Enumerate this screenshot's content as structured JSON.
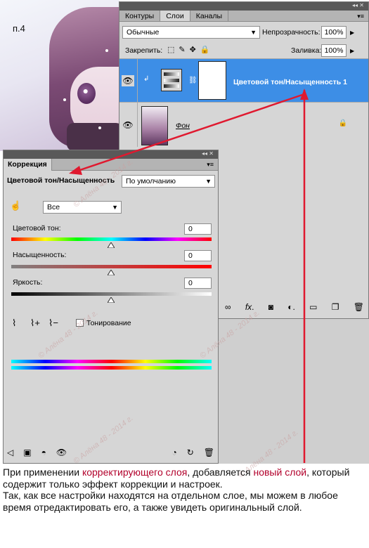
{
  "step_label": "п.4",
  "layers_panel": {
    "tabs": [
      "Контуры",
      "Слои",
      "Каналы"
    ],
    "active_tab": "Слои",
    "blend_mode": "Обычные",
    "opacity_label": "Непрозрачность:",
    "opacity_value": "100%",
    "lock_label": "Закрепить:",
    "fill_label": "Заливка:",
    "fill_value": "100%",
    "layers": [
      {
        "name": "Цветовой тон/Насыщенность 1",
        "selected": true
      },
      {
        "name": "Фон",
        "selected": false
      }
    ]
  },
  "correction_panel": {
    "tab": "Коррекция",
    "adjustment_title": "Цветовой тон/Насыщенность",
    "preset": "По умолчанию",
    "channel": "Все",
    "hue_label": "Цветовой тон:",
    "hue_value": "0",
    "saturation_label": "Насыщенность:",
    "saturation_value": "0",
    "lightness_label": "Яркость:",
    "lightness_value": "0",
    "colorize_label": "Тонирование"
  },
  "caption": {
    "p1_a": "При применении ",
    "p1_b": "корректирующего слоя",
    "p1_c": ", добавляется ",
    "p1_d": "новый слой",
    "p1_e": ", который содержит только эффект коррекции и настроек.",
    "p2": "Так, как все настройки находятся на отдельном слое, мы можем в любое время отредактировать его, а также увидеть оригинальный слой."
  },
  "watermark": "© Алёна 48 - 2014 г.",
  "colors": {
    "selection": "#3d8ee6",
    "arrow": "#e0192f",
    "highlight_text": "#b2002b"
  }
}
